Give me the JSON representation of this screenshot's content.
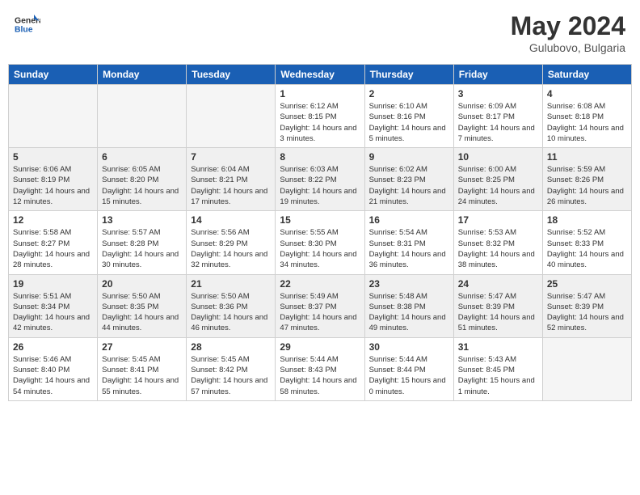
{
  "header": {
    "logo_general": "General",
    "logo_blue": "Blue",
    "month_year": "May 2024",
    "location": "Gulubovo, Bulgaria"
  },
  "weekdays": [
    "Sunday",
    "Monday",
    "Tuesday",
    "Wednesday",
    "Thursday",
    "Friday",
    "Saturday"
  ],
  "weeks": [
    [
      {
        "day": "",
        "sunrise": "",
        "sunset": "",
        "daylight": "",
        "empty": true
      },
      {
        "day": "",
        "sunrise": "",
        "sunset": "",
        "daylight": "",
        "empty": true
      },
      {
        "day": "",
        "sunrise": "",
        "sunset": "",
        "daylight": "",
        "empty": true
      },
      {
        "day": "1",
        "sunrise": "Sunrise: 6:12 AM",
        "sunset": "Sunset: 8:15 PM",
        "daylight": "Daylight: 14 hours and 3 minutes."
      },
      {
        "day": "2",
        "sunrise": "Sunrise: 6:10 AM",
        "sunset": "Sunset: 8:16 PM",
        "daylight": "Daylight: 14 hours and 5 minutes."
      },
      {
        "day": "3",
        "sunrise": "Sunrise: 6:09 AM",
        "sunset": "Sunset: 8:17 PM",
        "daylight": "Daylight: 14 hours and 7 minutes."
      },
      {
        "day": "4",
        "sunrise": "Sunrise: 6:08 AM",
        "sunset": "Sunset: 8:18 PM",
        "daylight": "Daylight: 14 hours and 10 minutes."
      }
    ],
    [
      {
        "day": "5",
        "sunrise": "Sunrise: 6:06 AM",
        "sunset": "Sunset: 8:19 PM",
        "daylight": "Daylight: 14 hours and 12 minutes."
      },
      {
        "day": "6",
        "sunrise": "Sunrise: 6:05 AM",
        "sunset": "Sunset: 8:20 PM",
        "daylight": "Daylight: 14 hours and 15 minutes."
      },
      {
        "day": "7",
        "sunrise": "Sunrise: 6:04 AM",
        "sunset": "Sunset: 8:21 PM",
        "daylight": "Daylight: 14 hours and 17 minutes."
      },
      {
        "day": "8",
        "sunrise": "Sunrise: 6:03 AM",
        "sunset": "Sunset: 8:22 PM",
        "daylight": "Daylight: 14 hours and 19 minutes."
      },
      {
        "day": "9",
        "sunrise": "Sunrise: 6:02 AM",
        "sunset": "Sunset: 8:23 PM",
        "daylight": "Daylight: 14 hours and 21 minutes."
      },
      {
        "day": "10",
        "sunrise": "Sunrise: 6:00 AM",
        "sunset": "Sunset: 8:25 PM",
        "daylight": "Daylight: 14 hours and 24 minutes."
      },
      {
        "day": "11",
        "sunrise": "Sunrise: 5:59 AM",
        "sunset": "Sunset: 8:26 PM",
        "daylight": "Daylight: 14 hours and 26 minutes."
      }
    ],
    [
      {
        "day": "12",
        "sunrise": "Sunrise: 5:58 AM",
        "sunset": "Sunset: 8:27 PM",
        "daylight": "Daylight: 14 hours and 28 minutes."
      },
      {
        "day": "13",
        "sunrise": "Sunrise: 5:57 AM",
        "sunset": "Sunset: 8:28 PM",
        "daylight": "Daylight: 14 hours and 30 minutes."
      },
      {
        "day": "14",
        "sunrise": "Sunrise: 5:56 AM",
        "sunset": "Sunset: 8:29 PM",
        "daylight": "Daylight: 14 hours and 32 minutes."
      },
      {
        "day": "15",
        "sunrise": "Sunrise: 5:55 AM",
        "sunset": "Sunset: 8:30 PM",
        "daylight": "Daylight: 14 hours and 34 minutes."
      },
      {
        "day": "16",
        "sunrise": "Sunrise: 5:54 AM",
        "sunset": "Sunset: 8:31 PM",
        "daylight": "Daylight: 14 hours and 36 minutes."
      },
      {
        "day": "17",
        "sunrise": "Sunrise: 5:53 AM",
        "sunset": "Sunset: 8:32 PM",
        "daylight": "Daylight: 14 hours and 38 minutes."
      },
      {
        "day": "18",
        "sunrise": "Sunrise: 5:52 AM",
        "sunset": "Sunset: 8:33 PM",
        "daylight": "Daylight: 14 hours and 40 minutes."
      }
    ],
    [
      {
        "day": "19",
        "sunrise": "Sunrise: 5:51 AM",
        "sunset": "Sunset: 8:34 PM",
        "daylight": "Daylight: 14 hours and 42 minutes."
      },
      {
        "day": "20",
        "sunrise": "Sunrise: 5:50 AM",
        "sunset": "Sunset: 8:35 PM",
        "daylight": "Daylight: 14 hours and 44 minutes."
      },
      {
        "day": "21",
        "sunrise": "Sunrise: 5:50 AM",
        "sunset": "Sunset: 8:36 PM",
        "daylight": "Daylight: 14 hours and 46 minutes."
      },
      {
        "day": "22",
        "sunrise": "Sunrise: 5:49 AM",
        "sunset": "Sunset: 8:37 PM",
        "daylight": "Daylight: 14 hours and 47 minutes."
      },
      {
        "day": "23",
        "sunrise": "Sunrise: 5:48 AM",
        "sunset": "Sunset: 8:38 PM",
        "daylight": "Daylight: 14 hours and 49 minutes."
      },
      {
        "day": "24",
        "sunrise": "Sunrise: 5:47 AM",
        "sunset": "Sunset: 8:39 PM",
        "daylight": "Daylight: 14 hours and 51 minutes."
      },
      {
        "day": "25",
        "sunrise": "Sunrise: 5:47 AM",
        "sunset": "Sunset: 8:39 PM",
        "daylight": "Daylight: 14 hours and 52 minutes."
      }
    ],
    [
      {
        "day": "26",
        "sunrise": "Sunrise: 5:46 AM",
        "sunset": "Sunset: 8:40 PM",
        "daylight": "Daylight: 14 hours and 54 minutes."
      },
      {
        "day": "27",
        "sunrise": "Sunrise: 5:45 AM",
        "sunset": "Sunset: 8:41 PM",
        "daylight": "Daylight: 14 hours and 55 minutes."
      },
      {
        "day": "28",
        "sunrise": "Sunrise: 5:45 AM",
        "sunset": "Sunset: 8:42 PM",
        "daylight": "Daylight: 14 hours and 57 minutes."
      },
      {
        "day": "29",
        "sunrise": "Sunrise: 5:44 AM",
        "sunset": "Sunset: 8:43 PM",
        "daylight": "Daylight: 14 hours and 58 minutes."
      },
      {
        "day": "30",
        "sunrise": "Sunrise: 5:44 AM",
        "sunset": "Sunset: 8:44 PM",
        "daylight": "Daylight: 15 hours and 0 minutes."
      },
      {
        "day": "31",
        "sunrise": "Sunrise: 5:43 AM",
        "sunset": "Sunset: 8:45 PM",
        "daylight": "Daylight: 15 hours and 1 minute."
      },
      {
        "day": "",
        "sunrise": "",
        "sunset": "",
        "daylight": "",
        "empty": true
      }
    ]
  ]
}
